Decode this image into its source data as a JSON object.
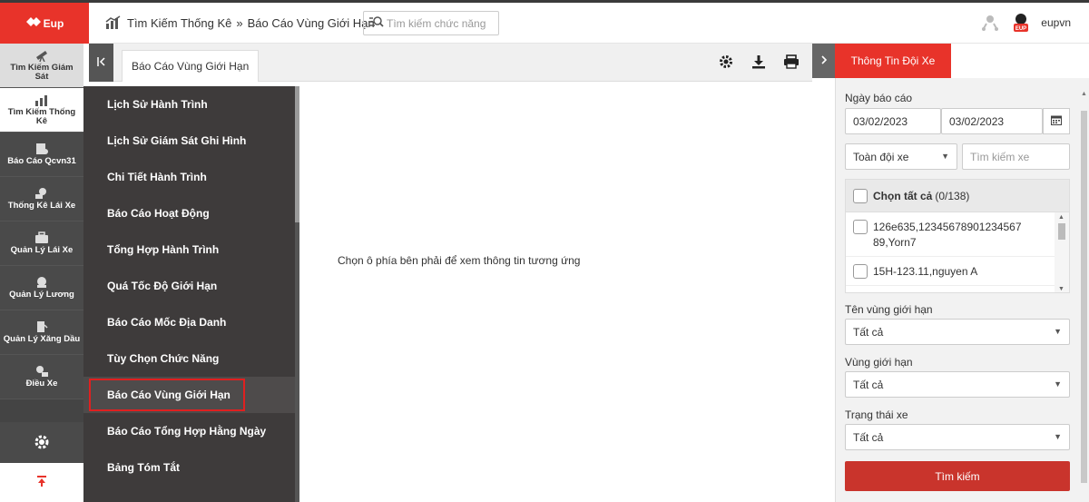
{
  "app": {
    "logo_text": "Eup",
    "brand_color": "#e8332a"
  },
  "header": {
    "breadcrumb": [
      "Tìm Kiếm Thống Kê",
      "Báo Cáo Vùng Giới Hạn"
    ],
    "breadcrumb_sep": "»",
    "search_placeholder": "Tìm kiếm chức năng",
    "username": "eupvn"
  },
  "iconbar": [
    {
      "label": "Tìm Kiếm Giám Sát",
      "icon": "telescope-icon"
    },
    {
      "label": "Tìm Kiếm Thống Kê",
      "icon": "chart-icon"
    },
    {
      "label": "Báo Cáo Qcvn31",
      "icon": "report-car-icon"
    },
    {
      "label": "Thống Kê Lái Xe",
      "icon": "driver-stats-icon"
    },
    {
      "label": "Quản Lý Lái Xe",
      "icon": "briefcase-icon"
    },
    {
      "label": "Quản Lý Lương",
      "icon": "salary-icon"
    },
    {
      "label": "Quản Lý Xăng Dầu",
      "icon": "fuel-icon"
    },
    {
      "label": "Điều Xe",
      "icon": "dispatch-icon"
    }
  ],
  "submenu": {
    "items": [
      "Lịch Sử Hành Trình",
      "Lịch Sử Giám Sát Ghi Hình",
      "Chi Tiết Hành Trình",
      "Báo Cáo Hoạt Động",
      "Tổng Hợp Hành Trình",
      "Quá Tốc Độ Giới Hạn",
      "Báo Cáo Mốc Địa Danh",
      "Tùy Chọn Chức Năng",
      "Báo Cáo Vùng Giới Hạn",
      "Báo Cáo Tổng Hợp Hằng Ngày",
      "Bảng Tóm Tắt"
    ],
    "selected_index": 8
  },
  "tabs": {
    "active": "Báo Cáo Vùng Giới Hạn"
  },
  "main": {
    "message": "Chọn ô phía bên phải để xem thông tin tương ứng"
  },
  "right_panel": {
    "title": "Thông Tin Đội Xe",
    "date_label": "Ngày báo cáo",
    "date_from": "03/02/2023",
    "date_to": "03/02/2023",
    "fleet_select": "Toàn đội xe",
    "vehicle_search_placeholder": "Tìm kiếm xe",
    "select_all_label": "Chọn tất cả",
    "select_all_count": "(0/138)",
    "vehicles": [
      "126e635,12345678901234567 89,Yorn7",
      "15H-123.11,nguyen A"
    ],
    "zone_name_label": "Tên vùng giới hạn",
    "zone_name_value": "Tất cả",
    "zone_label": "Vùng giới hạn",
    "zone_value": "Tất cả",
    "status_label": "Trạng thái xe",
    "status_value": "Tất cả",
    "search_button": "Tìm kiếm"
  }
}
